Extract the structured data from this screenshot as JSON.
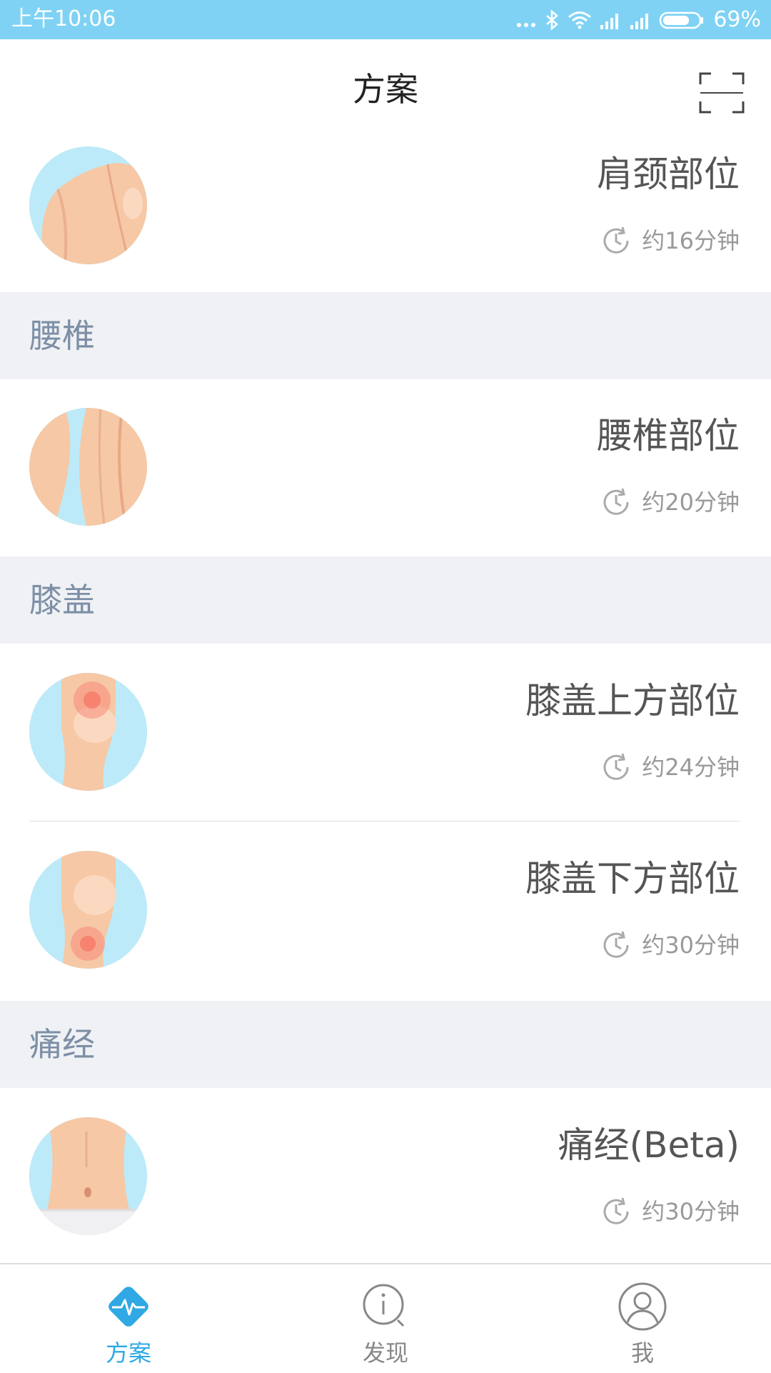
{
  "status_bar": {
    "time": "上午10:06",
    "battery": "69%"
  },
  "header": {
    "title": "方案"
  },
  "list": [
    {
      "title": "肩颈部位",
      "duration": "约16分钟"
    },
    {
      "section": "腰椎"
    },
    {
      "title": "腰椎部位",
      "duration": "约20分钟"
    },
    {
      "section": "膝盖"
    },
    {
      "title": "膝盖上方部位",
      "duration": "约24分钟"
    },
    {
      "title": "膝盖下方部位",
      "duration": "约30分钟"
    },
    {
      "section": "痛经"
    },
    {
      "title": "痛经(Beta)",
      "duration": "约30分钟"
    }
  ],
  "tabs": [
    {
      "label": "方案",
      "icon": "pulse-diamond-icon",
      "active": true
    },
    {
      "label": "发现",
      "icon": "discover-icon",
      "active": false
    },
    {
      "label": "我",
      "icon": "profile-icon",
      "active": false
    }
  ],
  "colors": {
    "status_bar": "#7fd2f4",
    "accent": "#2fa8e4",
    "section_bg": "#eff1f4",
    "section_text": "#7d8fa6"
  }
}
